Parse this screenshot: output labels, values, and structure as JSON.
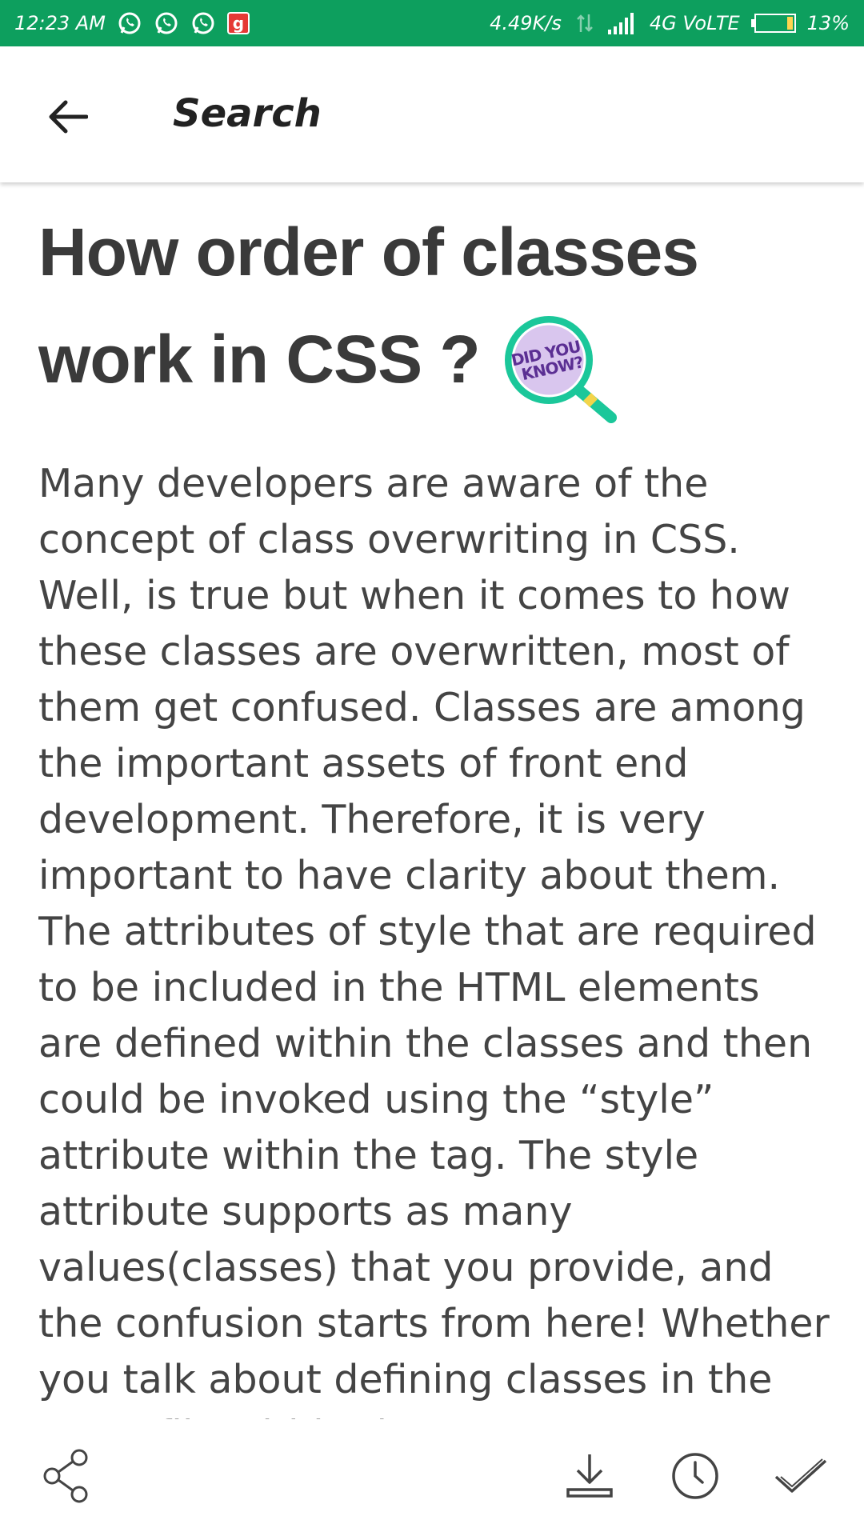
{
  "status_bar": {
    "time": "12:23 AM",
    "net_speed": "4.49K/s",
    "network": "4G VoLTE",
    "battery": "13%",
    "g_label": "g"
  },
  "app_bar": {
    "title": "Search"
  },
  "article": {
    "title_line1": "How order of classes",
    "title_line2": "work in CSS ?",
    "badge_text_1": "DID YOU",
    "badge_text_2": "KNOW?",
    "body": "Many developers are aware of the concept of class overwriting in CSS. Well, is true but when it comes to how these classes are overwritten, most of them get confused. Classes are among the important assets of front end development. Therefore, it is very important to have clarity about them. The attributes of style that are required to be included in the HTML elements are defined within the classes and then could be invoked using the “style” attribute within the tag. The style attribute supports as many values(classes) that you provide, and the confusion starts from here! Whether you talk about defining classes in the same file within the"
  },
  "colors": {
    "status_bar": "#0d9f5e",
    "accent": "#1bc79a"
  }
}
